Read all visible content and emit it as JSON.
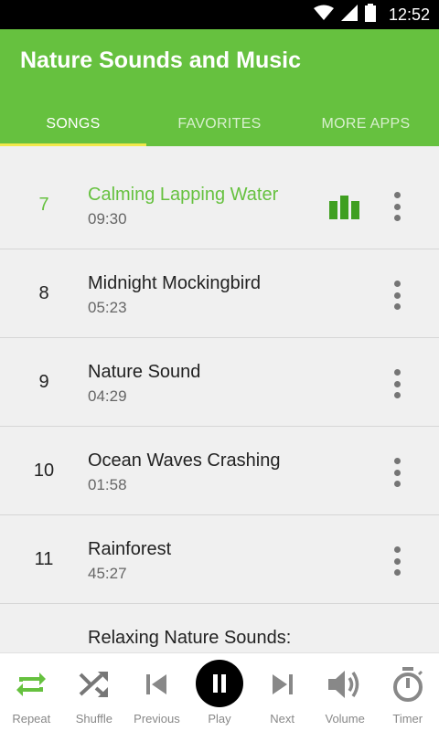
{
  "status_bar": {
    "time": "12:52"
  },
  "app": {
    "title": "Nature Sounds and Music"
  },
  "tabs": [
    {
      "label": "SONGS",
      "active": true
    },
    {
      "label": "FAVORITES",
      "active": false
    },
    {
      "label": "MORE APPS",
      "active": false
    }
  ],
  "songs": [
    {
      "number": "7",
      "title": "Calming Lapping Water",
      "duration": "09:30",
      "playing": true
    },
    {
      "number": "8",
      "title": "Midnight Mockingbird",
      "duration": "05:23",
      "playing": false
    },
    {
      "number": "9",
      "title": "Nature Sound",
      "duration": "04:29",
      "playing": false
    },
    {
      "number": "10",
      "title": "Ocean Waves Crashing",
      "duration": "01:58",
      "playing": false
    },
    {
      "number": "11",
      "title": "Rainforest",
      "duration": "45:27",
      "playing": false
    },
    {
      "number": "",
      "title": "Relaxing Nature Sounds:",
      "duration": "",
      "playing": false
    }
  ],
  "controls": {
    "repeat": "Repeat",
    "shuffle": "Shuffle",
    "previous": "Previous",
    "play": "Play",
    "next": "Next",
    "volume": "Volume",
    "timer": "Timer"
  },
  "colors": {
    "accent": "#66c13f",
    "tab_indicator": "#f2e84a",
    "equalizer": "#3f9f20"
  }
}
